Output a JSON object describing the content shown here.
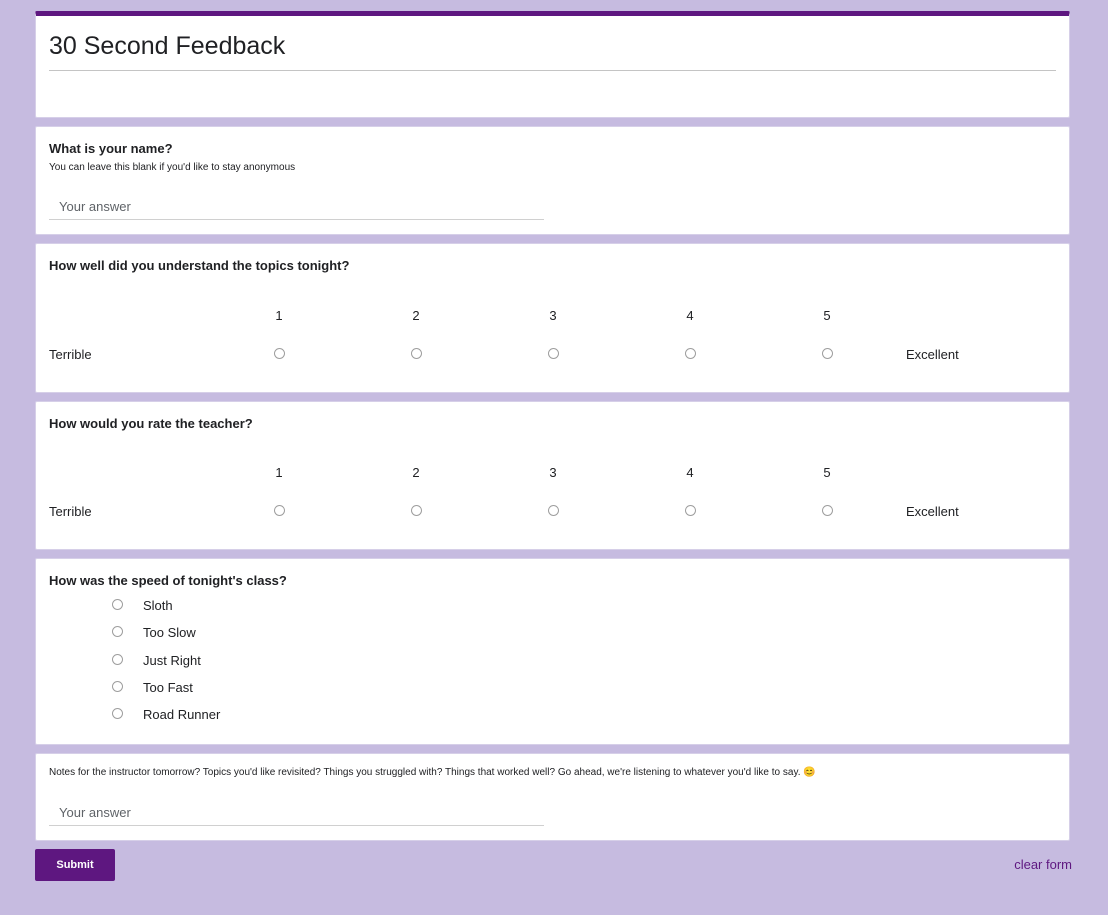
{
  "form": {
    "title": "30 Second Feedback"
  },
  "q_name": {
    "title": "What is your name?",
    "help": "You can leave this blank if you'd like to stay anonymous",
    "placeholder": "Your answer",
    "value": ""
  },
  "q_topics": {
    "title": "How well did you understand the topics tonight?",
    "min_label": "Terrible",
    "max_label": "Excellent",
    "scale": [
      "1",
      "2",
      "3",
      "4",
      "5"
    ],
    "selected": null
  },
  "q_teacher": {
    "title": "How would you rate the teacher?",
    "min_label": "Terrible",
    "max_label": "Excellent",
    "scale": [
      "1",
      "2",
      "3",
      "4",
      "5"
    ],
    "selected": null
  },
  "q_speed": {
    "title": "How was the speed of tonight's class?",
    "options": [
      "Sloth",
      "Too Slow",
      "Just Right",
      "Too Fast",
      "Road Runner"
    ],
    "selected": null
  },
  "q_notes": {
    "title": "Notes for the instructor tomorrow? Topics you'd like revisited? Things you struggled with? Things that worked well? Go ahead, we're listening to whatever you'd like to say. 😊",
    "placeholder": "Your answer",
    "value": ""
  },
  "actions": {
    "submit_label": "Submit",
    "clear_label": "clear form"
  },
  "colors": {
    "background": "#c6bbe0",
    "accent": "#5e1780"
  }
}
